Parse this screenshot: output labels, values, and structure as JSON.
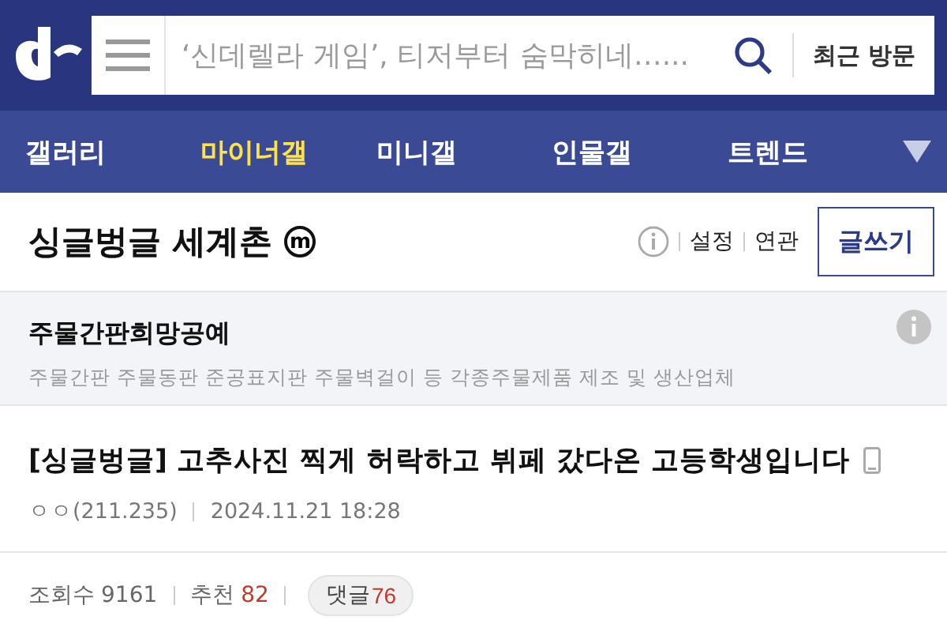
{
  "search": {
    "placeholder": "‘신데렐라 게임’, 티저부터 숨막히네…..."
  },
  "recent_button": "최근 방문",
  "nav_tabs": [
    {
      "label": "갤러리",
      "selected": false
    },
    {
      "label": "마이너갤",
      "selected": true
    },
    {
      "label": "미니갤",
      "selected": false
    },
    {
      "label": "인물갤",
      "selected": false
    },
    {
      "label": "트렌드",
      "selected": false
    }
  ],
  "gallery": {
    "title": "싱글벙글 세계촌",
    "badge": "m",
    "links": [
      "설정",
      "연관"
    ],
    "write_button": "글쓰기"
  },
  "notice": {
    "title": "주물간판희망공예",
    "description": "주물간판 주물동판 준공표지판 주물벽걸이 등 각종주물제품 제조 및 생산업체"
  },
  "post": {
    "title": "[싱글벙글] 고추사진 찍게 허락하고 뷔페 갔다온 고등학생입니다",
    "author": "ㅇㅇ(211.235)",
    "date": "2024.11.21 18:28"
  },
  "stats": {
    "views_label": "조회수",
    "views": "9161",
    "likes_label": "추천",
    "likes": "82",
    "comments_label": "댓글",
    "comments": "76"
  }
}
